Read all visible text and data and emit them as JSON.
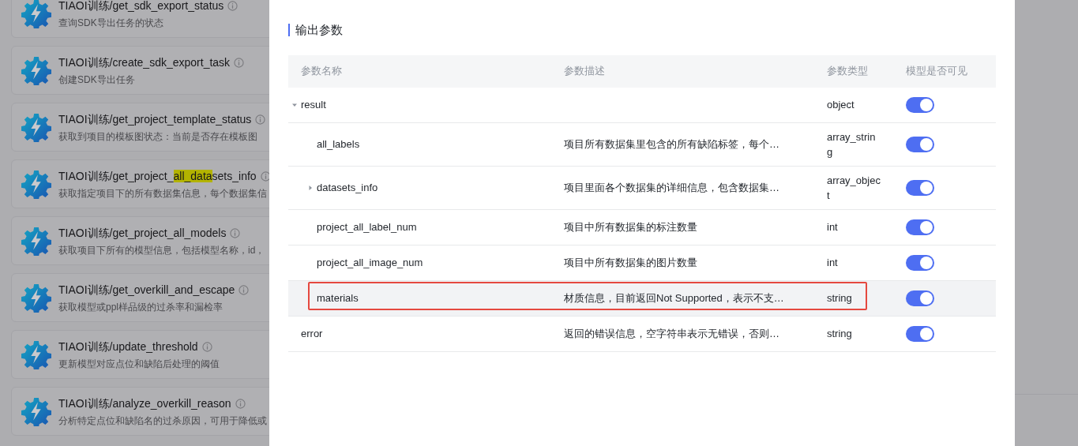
{
  "tools": [
    {
      "title_parts": [
        {
          "text": "TIAOI训练/get_sdk_export_status",
          "highlighted": false
        }
      ],
      "description": "查询SDK导出任务的状态"
    },
    {
      "title_parts": [
        {
          "text": "TIAOI训练/create_sdk_export_task",
          "highlighted": false
        }
      ],
      "description": "创建SDK导出任务"
    },
    {
      "title_parts": [
        {
          "text": "TIAOI训练/get_project_template_status",
          "highlighted": false
        }
      ],
      "description": "获取到项目的模板图状态：当前是否存在模板图"
    },
    {
      "title_parts": [
        {
          "text": "TIAOI训练/get_project_",
          "highlighted": false
        },
        {
          "text": "all_data",
          "highlighted": true
        },
        {
          "text": "sets_info",
          "highlighted": false
        }
      ],
      "description": "获取指定项目下的所有数据集信息，每个数据集信"
    },
    {
      "title_parts": [
        {
          "text": "TIAOI训练/get_project_all_models",
          "highlighted": false
        }
      ],
      "description": "获取项目下所有的模型信息，包括模型名称，id，"
    },
    {
      "title_parts": [
        {
          "text": "TIAOI训练/get_overkill_and_escape",
          "highlighted": false
        }
      ],
      "description": "获取模型或ppl样品级的过杀率和漏检率"
    },
    {
      "title_parts": [
        {
          "text": "TIAOI训练/update_threshold",
          "highlighted": false
        }
      ],
      "description": "更新模型对应点位和缺陷后处理的阈值"
    },
    {
      "title_parts": [
        {
          "text": "TIAOI训练/analyze_overkill_reason",
          "highlighted": false
        }
      ],
      "description": "分析特定点位和缺陷名的过杀原因，可用于降低或"
    }
  ],
  "modal": {
    "section_title": "输出参数",
    "table": {
      "columns": [
        "参数名称",
        "参数描述",
        "参数类型",
        "模型是否可见"
      ],
      "rows": [
        {
          "name": "result",
          "description": "",
          "type": "object",
          "visible": true,
          "highlighted": false,
          "expanded": true,
          "children": [
            {
              "name": "all_labels",
              "description": "项目所有数据集里包含的所有缺陷标签，每个…",
              "type": "array_string",
              "visible": true,
              "highlighted": false
            },
            {
              "name": "datasets_info",
              "description": "项目里面各个数据集的详细信息，包含数据集…",
              "type": "array_object",
              "visible": true,
              "highlighted": false,
              "expanded": false
            },
            {
              "name": "project_all_label_num",
              "description": "项目中所有数据集的标注数量",
              "type": "int",
              "visible": true,
              "highlighted": false
            },
            {
              "name": "project_all_image_num",
              "description": "项目中所有数据集的图片数量",
              "type": "int",
              "visible": true,
              "highlighted": false
            },
            {
              "name": "materials",
              "description": "材质信息，目前返回Not Supported，表示不支…",
              "type": "string",
              "visible": true,
              "highlighted": true
            }
          ]
        },
        {
          "name": "error",
          "description": "返回的错误信息，空字符串表示无错误，否则…",
          "type": "string",
          "visible": true,
          "highlighted": false
        }
      ]
    }
  }
}
